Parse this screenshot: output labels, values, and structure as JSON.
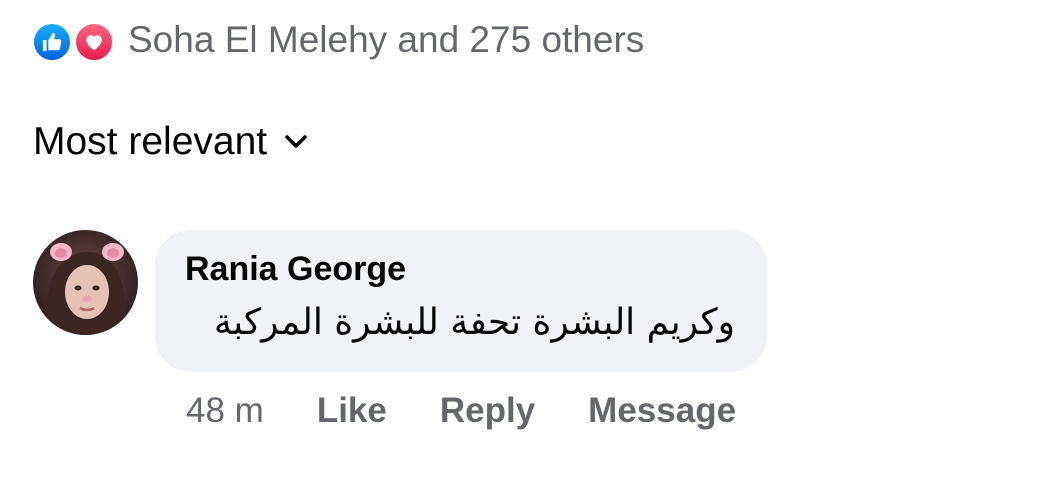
{
  "reactions": {
    "icons": [
      "thumbs-up-icon",
      "heart-icon"
    ],
    "summary": "Soha El Melehy and 275 others",
    "colors": {
      "like": "#1877f2",
      "love": "#f33e58"
    }
  },
  "sort": {
    "label": "Most relevant",
    "icon": "chevron-down-icon"
  },
  "comment": {
    "author": "Rania George",
    "text": "وكريم البشرة تحفة للبشرة المركبة",
    "time": "48 m",
    "actions": {
      "like": "Like",
      "reply": "Reply",
      "message": "Message"
    }
  }
}
